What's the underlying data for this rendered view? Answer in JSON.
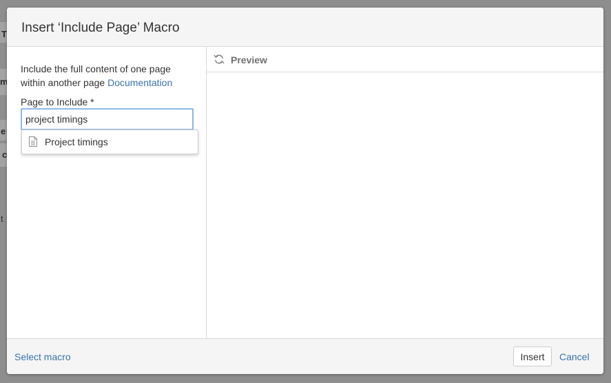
{
  "background": {
    "fragments": [
      "T",
      "m",
      "e",
      "c",
      "t"
    ]
  },
  "dialog": {
    "title": "Insert ‘Include Page’ Macro",
    "description": {
      "text": "Include the full content of one page within another page",
      "link_label": "Documentation"
    },
    "page_field": {
      "label": "Page to Include *",
      "value": "project timings"
    },
    "suggestions": [
      {
        "label": "Project timings",
        "icon": "page-icon"
      }
    ],
    "preview": {
      "label": "Preview",
      "icon": "refresh-icon"
    },
    "footer": {
      "select_macro_label": "Select macro",
      "insert_label": "Insert",
      "cancel_label": "Cancel"
    }
  },
  "colors": {
    "link": "#3b73af",
    "input_focus_border": "#8eb8e6",
    "overlay": "#8e8e8e"
  }
}
